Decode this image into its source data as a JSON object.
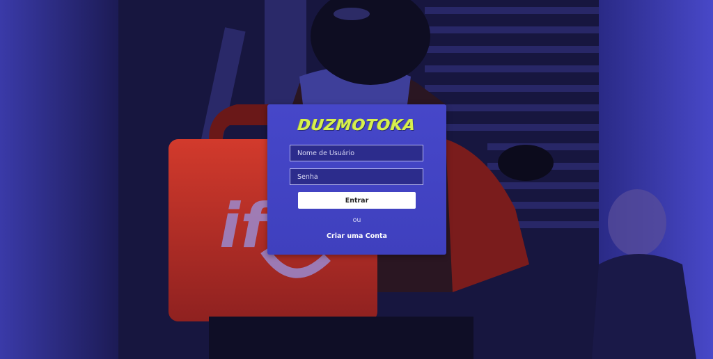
{
  "app": {
    "brand": "DUZMOTOKA"
  },
  "login": {
    "username_placeholder": "Nome de Usuário",
    "password_placeholder": "Senha",
    "submit_label": "Entrar",
    "separator": "ou",
    "create_account_label": "Criar uma Conta"
  },
  "background": {
    "scene_text": "ifood"
  },
  "colors": {
    "card": "#4142c2",
    "field_bg": "#2c2c8c",
    "logo": "#d7ef4e",
    "button": "#ffffff"
  }
}
